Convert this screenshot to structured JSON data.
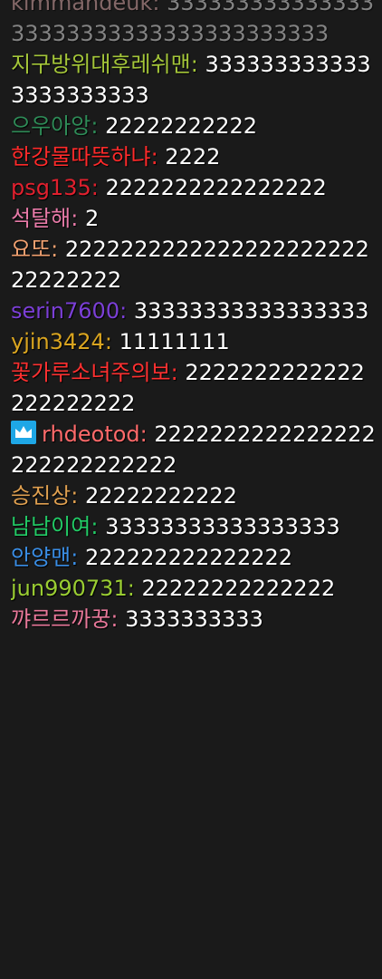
{
  "chat": {
    "messages": [
      {
        "nick": "kimmandeuk",
        "separator": ":",
        "text": "33333333333333333333333333333333333333",
        "nick_color": "#d9a6a6",
        "text_color": "#d9d9d9",
        "faded": true
      },
      {
        "nick": "지구방위대후레쉬맨",
        "separator": ":",
        "text": "3333333333333333333333",
        "nick_color": "#a4c639",
        "text_color": "#ffffff"
      },
      {
        "nick": "으우아앙",
        "separator": ":",
        "text": "22222222222",
        "nick_color": "#2e8b57",
        "text_color": "#ffffff"
      },
      {
        "nick": "한강물따뜻하냐",
        "separator": ":",
        "text": "2222",
        "nick_color": "#ff2a2a",
        "text_color": "#ffffff"
      },
      {
        "nick": "psg135",
        "separator": ":",
        "text": "2222222222222222",
        "nick_color": "#e0202e",
        "text_color": "#ffffff"
      },
      {
        "nick": "석탈해",
        "separator": ":",
        "text": "2",
        "nick_color": "#e87aa8",
        "text_color": "#ffffff"
      },
      {
        "nick": "요또",
        "separator": ":",
        "text": "222222222222222222222222222222",
        "nick_color": "#f0a070",
        "text_color": "#ffffff"
      },
      {
        "nick": "serin7600",
        "separator": ":",
        "text": "33333333333333333",
        "nick_color": "#7b3fd6",
        "text_color": "#ffffff"
      },
      {
        "nick": "yjin3424",
        "separator": ":",
        "text": "11111111",
        "nick_color": "#daa520",
        "text_color": "#ffffff"
      },
      {
        "nick": "꽃가루소녀주의보",
        "separator": ":",
        "text": "2222222222222222222222",
        "nick_color": "#ff3030",
        "text_color": "#ffffff"
      },
      {
        "nick": "rhdeotod",
        "separator": ":",
        "text": "2222222222222222222222222222",
        "nick_color": "#ff6a6a",
        "text_color": "#ffffff",
        "badge": "crown-icon",
        "badge_color": "#1ea7e6"
      },
      {
        "nick": "승진상",
        "separator": ":",
        "text": "22222222222",
        "nick_color": "#e0a050",
        "text_color": "#ffffff"
      },
      {
        "nick": "남남이여",
        "separator": ":",
        "text": "33333333333333333",
        "nick_color": "#22cc66",
        "text_color": "#ffffff"
      },
      {
        "nick": "안양맨",
        "separator": ":",
        "text": "222222222222222",
        "nick_color": "#3a8ee6",
        "text_color": "#ffffff"
      },
      {
        "nick": "jun990731",
        "separator": ":",
        "text": "22222222222222",
        "nick_color": "#9acd32",
        "text_color": "#ffffff"
      },
      {
        "nick": "꺄르르까꿍",
        "separator": ":",
        "text": "3333333333",
        "nick_color": "#e8789a",
        "text_color": "#ffffff"
      }
    ]
  }
}
